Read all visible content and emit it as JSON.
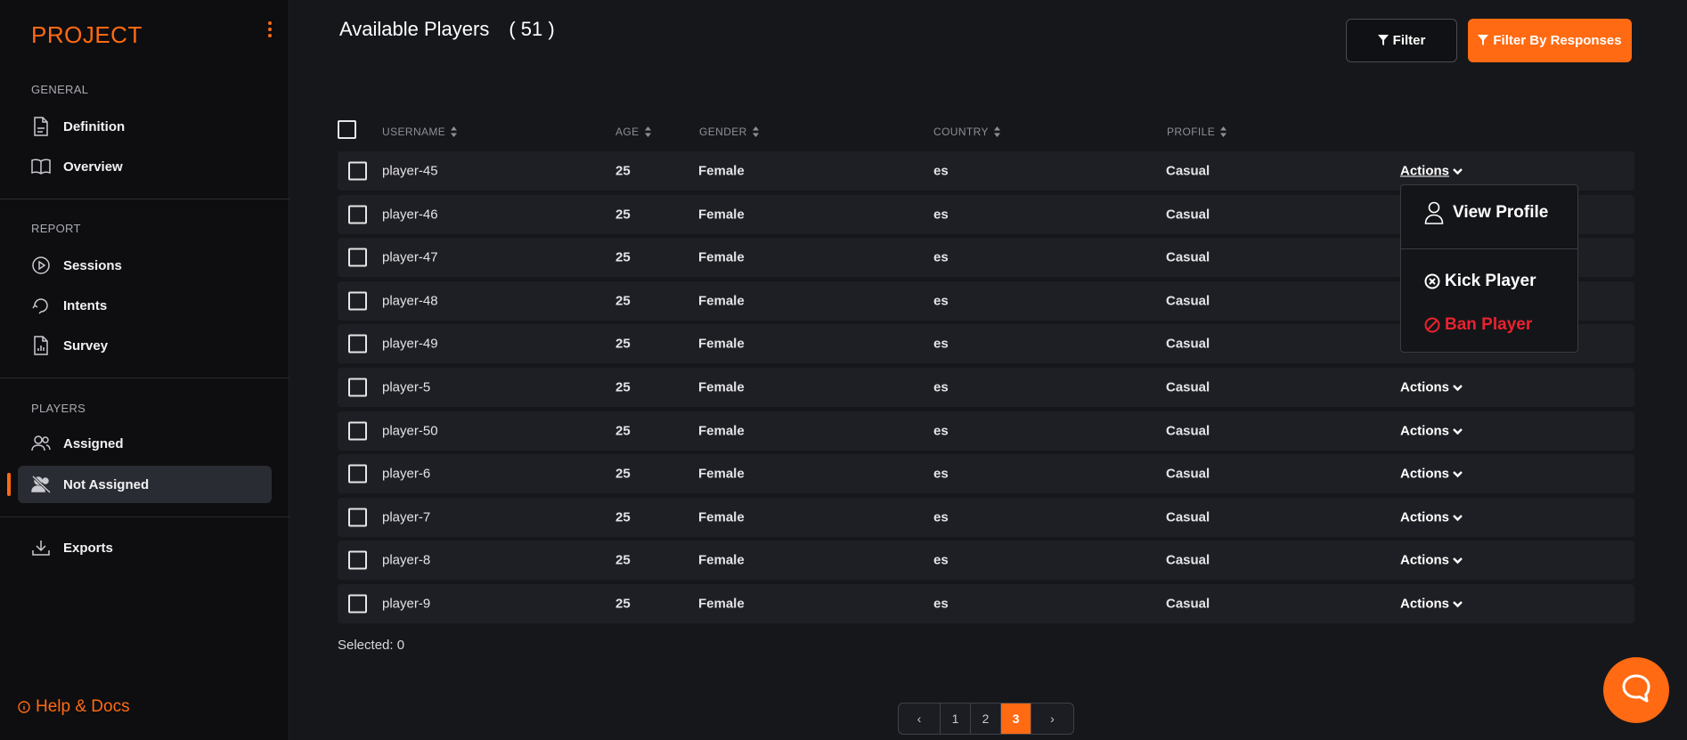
{
  "sidebar": {
    "brand": "PROJECT",
    "sections": [
      {
        "label": "GENERAL",
        "items": [
          {
            "label": "Definition",
            "icon": "document-icon"
          },
          {
            "label": "Overview",
            "icon": "book-icon"
          }
        ]
      },
      {
        "label": "REPORT",
        "items": [
          {
            "label": "Sessions",
            "icon": "play-circle-icon"
          },
          {
            "label": "Intents",
            "icon": "intents-icon"
          },
          {
            "label": "Survey",
            "icon": "survey-icon"
          }
        ]
      },
      {
        "label": "PLAYERS",
        "items": [
          {
            "label": "Assigned",
            "icon": "users-icon"
          },
          {
            "label": "Not Assigned",
            "icon": "users-off-icon",
            "active": true
          }
        ]
      }
    ],
    "exports": "Exports",
    "help": "Help & Docs"
  },
  "header": {
    "title": "Available Players",
    "count": "( 51 )",
    "filter_label": "Filter",
    "filter_responses_label": "Filter By Responses"
  },
  "table": {
    "columns": [
      "USERNAME",
      "AGE",
      "GENDER",
      "COUNTRY",
      "PROFILE"
    ],
    "rows": [
      {
        "username": "player-45",
        "age": "25",
        "gender": "Female",
        "country": "es",
        "profile": "Casual",
        "actions": "Actions"
      },
      {
        "username": "player-46",
        "age": "25",
        "gender": "Female",
        "country": "es",
        "profile": "Casual",
        "actions": ""
      },
      {
        "username": "player-47",
        "age": "25",
        "gender": "Female",
        "country": "es",
        "profile": "Casual",
        "actions": ""
      },
      {
        "username": "player-48",
        "age": "25",
        "gender": "Female",
        "country": "es",
        "profile": "Casual",
        "actions": ""
      },
      {
        "username": "player-49",
        "age": "25",
        "gender": "Female",
        "country": "es",
        "profile": "Casual",
        "actions": ""
      },
      {
        "username": "player-5",
        "age": "25",
        "gender": "Female",
        "country": "es",
        "profile": "Casual",
        "actions": "Actions"
      },
      {
        "username": "player-50",
        "age": "25",
        "gender": "Female",
        "country": "es",
        "profile": "Casual",
        "actions": "Actions"
      },
      {
        "username": "player-6",
        "age": "25",
        "gender": "Female",
        "country": "es",
        "profile": "Casual",
        "actions": "Actions"
      },
      {
        "username": "player-7",
        "age": "25",
        "gender": "Female",
        "country": "es",
        "profile": "Casual",
        "actions": "Actions"
      },
      {
        "username": "player-8",
        "age": "25",
        "gender": "Female",
        "country": "es",
        "profile": "Casual",
        "actions": "Actions"
      },
      {
        "username": "player-9",
        "age": "25",
        "gender": "Female",
        "country": "es",
        "profile": "Casual",
        "actions": "Actions"
      }
    ],
    "selected_text": "Selected: 0"
  },
  "actions_menu": {
    "view_profile": "View Profile",
    "kick_player": "Kick Player",
    "ban_player": "Ban Player"
  },
  "pagination": {
    "prev": "‹",
    "pages": [
      "1",
      "2",
      "3"
    ],
    "current": "3",
    "next": "›"
  },
  "colors": {
    "accent": "#ff6a13",
    "danger": "#e8232e",
    "background": "#16171b",
    "row": "#1e1f24"
  }
}
